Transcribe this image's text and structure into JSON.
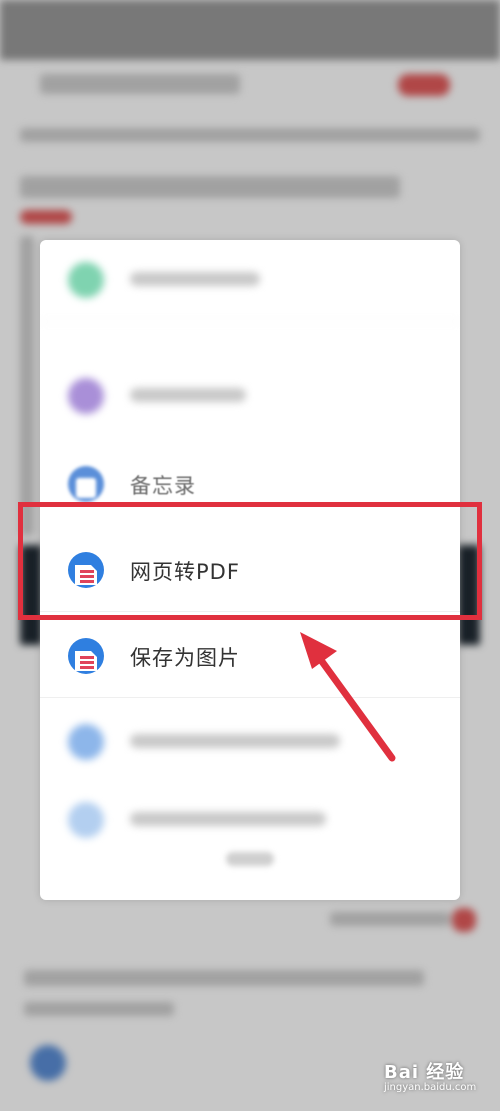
{
  "share_sheet": {
    "items": [
      {
        "label": "",
        "icon": "green-app-icon",
        "visible": false
      },
      {
        "label": "",
        "icon": "purple-app-icon",
        "visible": false
      },
      {
        "label": "备忘录",
        "icon": "memo-icon",
        "visible": true
      },
      {
        "label": "网页转PDF",
        "icon": "pdf-document-icon",
        "visible": true,
        "highlighted": true
      },
      {
        "label": "保存为图片",
        "icon": "save-image-icon",
        "visible": true
      },
      {
        "label": "",
        "icon": "blue-app-icon",
        "visible": false
      },
      {
        "label": "",
        "icon": "blue-app-icon",
        "visible": false
      }
    ]
  },
  "annotation": {
    "highlight_color": "#e0303e",
    "arrow_color": "#e0303e"
  },
  "watermark": {
    "brand": "Bai 经验",
    "url": "jingyan.baidu.com"
  },
  "colors": {
    "accent_blue": "#2f7fe0",
    "doc_red": "#e0435a"
  }
}
